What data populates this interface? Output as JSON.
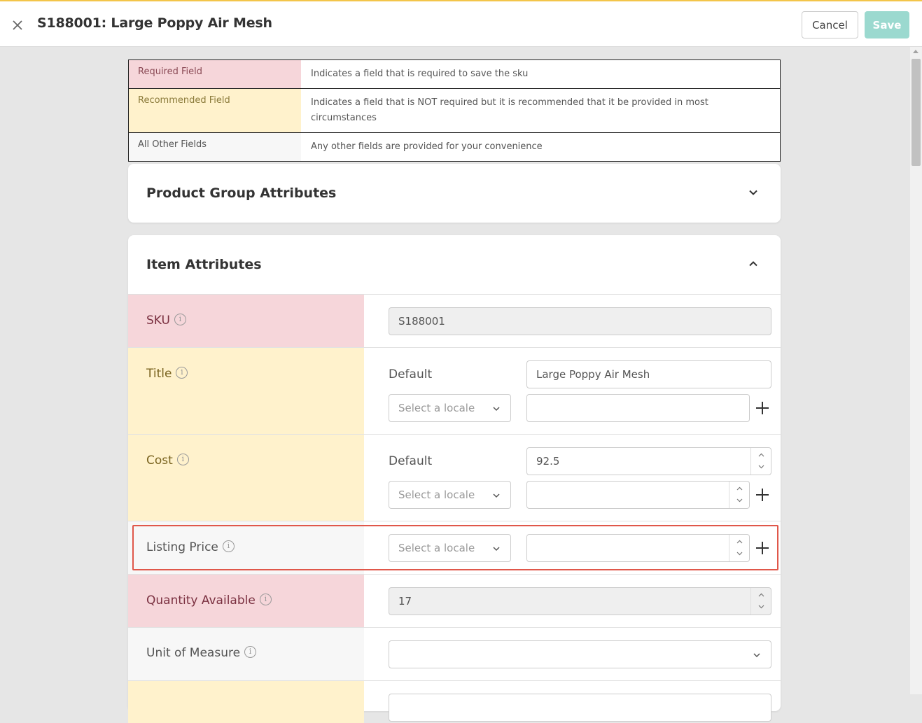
{
  "header": {
    "title": "S188001: Large Poppy Air Mesh",
    "cancel_label": "Cancel",
    "save_label": "Save"
  },
  "legend": [
    {
      "key": "Required Field",
      "desc": "Indicates a field that is required to save the sku"
    },
    {
      "key": "Recommended Field",
      "desc": "Indicates a field that is NOT required but it is recommended that it be provided in most circumstances"
    },
    {
      "key": "All Other Fields",
      "desc": "Any other fields are provided for your convenience"
    }
  ],
  "sections": {
    "product_group": {
      "title": "Product Group Attributes"
    },
    "item_attributes": {
      "title": "Item Attributes"
    }
  },
  "attributes": {
    "sku": {
      "label": "SKU",
      "value": "S188001"
    },
    "title": {
      "label": "Title",
      "default_label": "Default",
      "value": "Large Poppy Air Mesh",
      "locale_placeholder": "Select a locale"
    },
    "cost": {
      "label": "Cost",
      "default_label": "Default",
      "value": "92.5",
      "locale_placeholder": "Select a locale"
    },
    "listing_price": {
      "label": "Listing Price",
      "locale_placeholder": "Select a locale"
    },
    "quantity_available": {
      "label": "Quantity Available",
      "value": "17"
    },
    "unit_of_measure": {
      "label": "Unit of Measure",
      "value": ""
    }
  },
  "colors": {
    "required": "#f6d6da",
    "recommended": "#fff2cc",
    "other": "#f7f7f7",
    "save_button": "#9bd9cf",
    "highlight": "#e0574a"
  },
  "icons": {
    "close": "close-icon",
    "info": "info-icon",
    "chevron_down": "chevron-down-icon",
    "chevron_up": "chevron-up-icon",
    "plus": "plus-icon"
  }
}
